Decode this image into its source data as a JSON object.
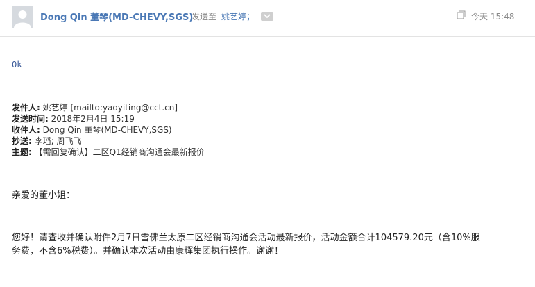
{
  "header": {
    "sender_name": "Dong Qin 董琴(MD-CHEVY,SGS)",
    "sent_to_label": "发送至",
    "recipient": "姚艺婷；",
    "time": "今天 15:48",
    "icons": [
      "avatar",
      "chevron-down-icon",
      "new-window-icon"
    ]
  },
  "message": {
    "reply": "Ok",
    "forward": {
      "from_label": "发件人:",
      "from_value": "姚艺婷 [mailto:yaoyiting@cct.cn]",
      "sent_label": "发送时间:",
      "sent_value": "2018年2月4日 15:19",
      "to_label": "收件人:",
      "to_value": "Dong Qin 董琴(MD-CHEVY,SGS)",
      "cc_label": "抄送:",
      "cc_value": "李瑫; 周飞飞",
      "subject_label": "主题:",
      "subject_value": "【需回复确认】二区Q1经销商沟通会最新报价"
    },
    "greeting": "亲爱的董小姐：",
    "paragraph_line1": "您好！请查收并确认附件2月7日雪佛兰太原二区经销商沟通会活动最新报价，活动金额合计104579.20元（含10%服",
    "paragraph_line2": "务费，不含6%税费）。并确认本次活动由康辉集团执行操作。谢谢！"
  }
}
